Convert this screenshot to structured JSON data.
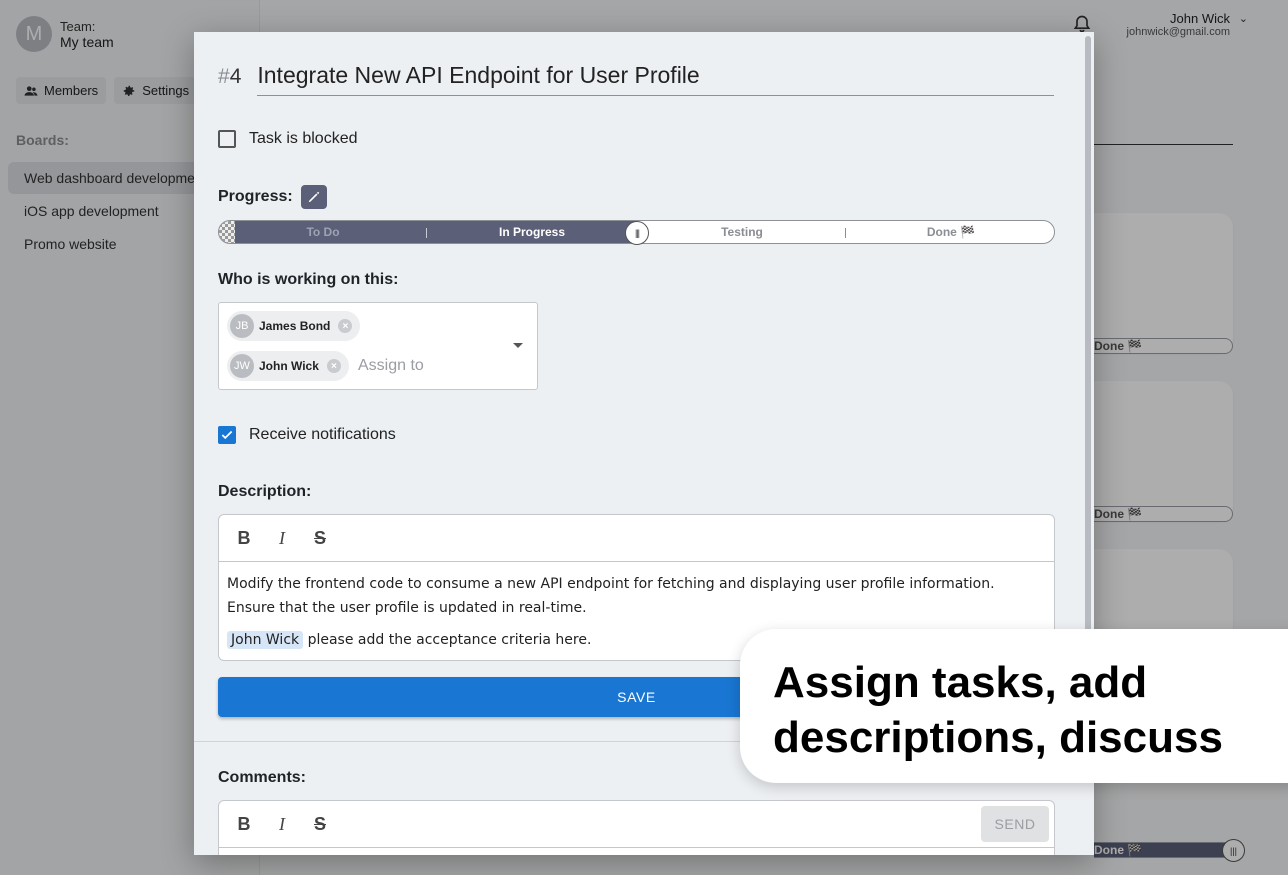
{
  "sidebar": {
    "avatar_letter": "M",
    "team_label": "Team:",
    "team_name": "My team",
    "members_label": "Members",
    "settings_label": "Settings",
    "boards_title": "Boards:",
    "boards": [
      {
        "label": "Web dashboard development",
        "active": true
      },
      {
        "label": "iOS app development",
        "active": false
      },
      {
        "label": "Promo website",
        "active": false
      }
    ]
  },
  "topbar": {
    "user_name": "John Wick",
    "user_email": "johnwick@gmail.com"
  },
  "background_cards": {
    "done_label": "Done 🏁"
  },
  "modal": {
    "task_hash": "#",
    "task_number": "4",
    "title": "Integrate New API Endpoint for User Profile",
    "blocked_label": "Task is blocked",
    "blocked_checked": false,
    "progress_label": "Progress:",
    "progress": {
      "stages": [
        "To Do",
        "In Progress",
        "Testing",
        "Done 🏁"
      ],
      "current_stage": "In Progress",
      "fill_fraction": 0.5
    },
    "assignees_label": "Who is working on this:",
    "assignees": [
      {
        "initials": "JB",
        "name": "James Bond"
      },
      {
        "initials": "JW",
        "name": "John Wick"
      }
    ],
    "assign_placeholder": "Assign to",
    "notifications_label": "Receive notifications",
    "notifications_checked": true,
    "description_label": "Description:",
    "description_text": "Modify the frontend code to consume a new API endpoint for fetching and displaying user profile information. Ensure that the user profile is updated in real-time.",
    "description_mention": "John Wick",
    "description_mention_text": " please add the acceptance criteria here.",
    "toolbar": {
      "bold": "B",
      "italic": "I",
      "strike": "S"
    },
    "save_label": "SAVE",
    "comments_label": "Comments:",
    "send_label": "SEND"
  },
  "callout": {
    "text": "Assign tasks, add descriptions, discuss"
  },
  "colors": {
    "primary": "#1976d2",
    "progress_fill": "#5b5f77",
    "mention_bg": "#d6e6f7"
  }
}
